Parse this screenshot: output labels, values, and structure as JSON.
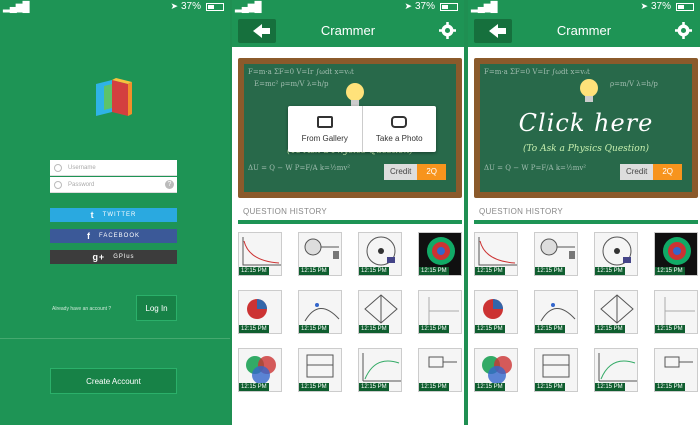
{
  "status_bar": {
    "battery": "37%"
  },
  "login": {
    "username_placeholder": "Username",
    "password_placeholder": "Password",
    "twitter_label": "TWITTER",
    "facebook_label": "FACEBOOK",
    "gplus_label": "GPlus",
    "already_text": "Already have an account ?",
    "login_label": "Log In",
    "create_label": "Create Account"
  },
  "app": {
    "title": "Crammer",
    "hint": "(To Ask a Physics Question)",
    "click_here": "Click here",
    "credit_label": "Credit",
    "credit_value": "2Q",
    "gallery_label": "From Gallery",
    "photo_label": "Take a Photo",
    "history_title": "QUESTION HISTORY"
  },
  "thumbnails": [
    {
      "time": "12:15 PM"
    },
    {
      "time": "12:15 PM"
    },
    {
      "time": "12:15 PM"
    },
    {
      "time": "12:15 PM"
    },
    {
      "time": "12:15 PM"
    },
    {
      "time": "12:15 PM"
    },
    {
      "time": "12:15 PM"
    },
    {
      "time": "12:15 PM"
    },
    {
      "time": "12:15 PM"
    },
    {
      "time": "12:15 PM"
    },
    {
      "time": "12:15 PM"
    },
    {
      "time": "12:15 PM"
    }
  ],
  "colors": {
    "brand_green": "#1e9455",
    "twitter": "#2aa9e0",
    "facebook": "#3b5998",
    "gplus": "#3c3c3c",
    "credit": "#f7941d"
  },
  "icons": [
    "book-logo-icon",
    "user-icon",
    "lock-icon",
    "help-icon",
    "twitter-icon",
    "facebook-icon",
    "gplus-icon",
    "back-arrow-icon",
    "gear-icon",
    "lightbulb-icon",
    "gallery-icon",
    "camera-icon"
  ]
}
